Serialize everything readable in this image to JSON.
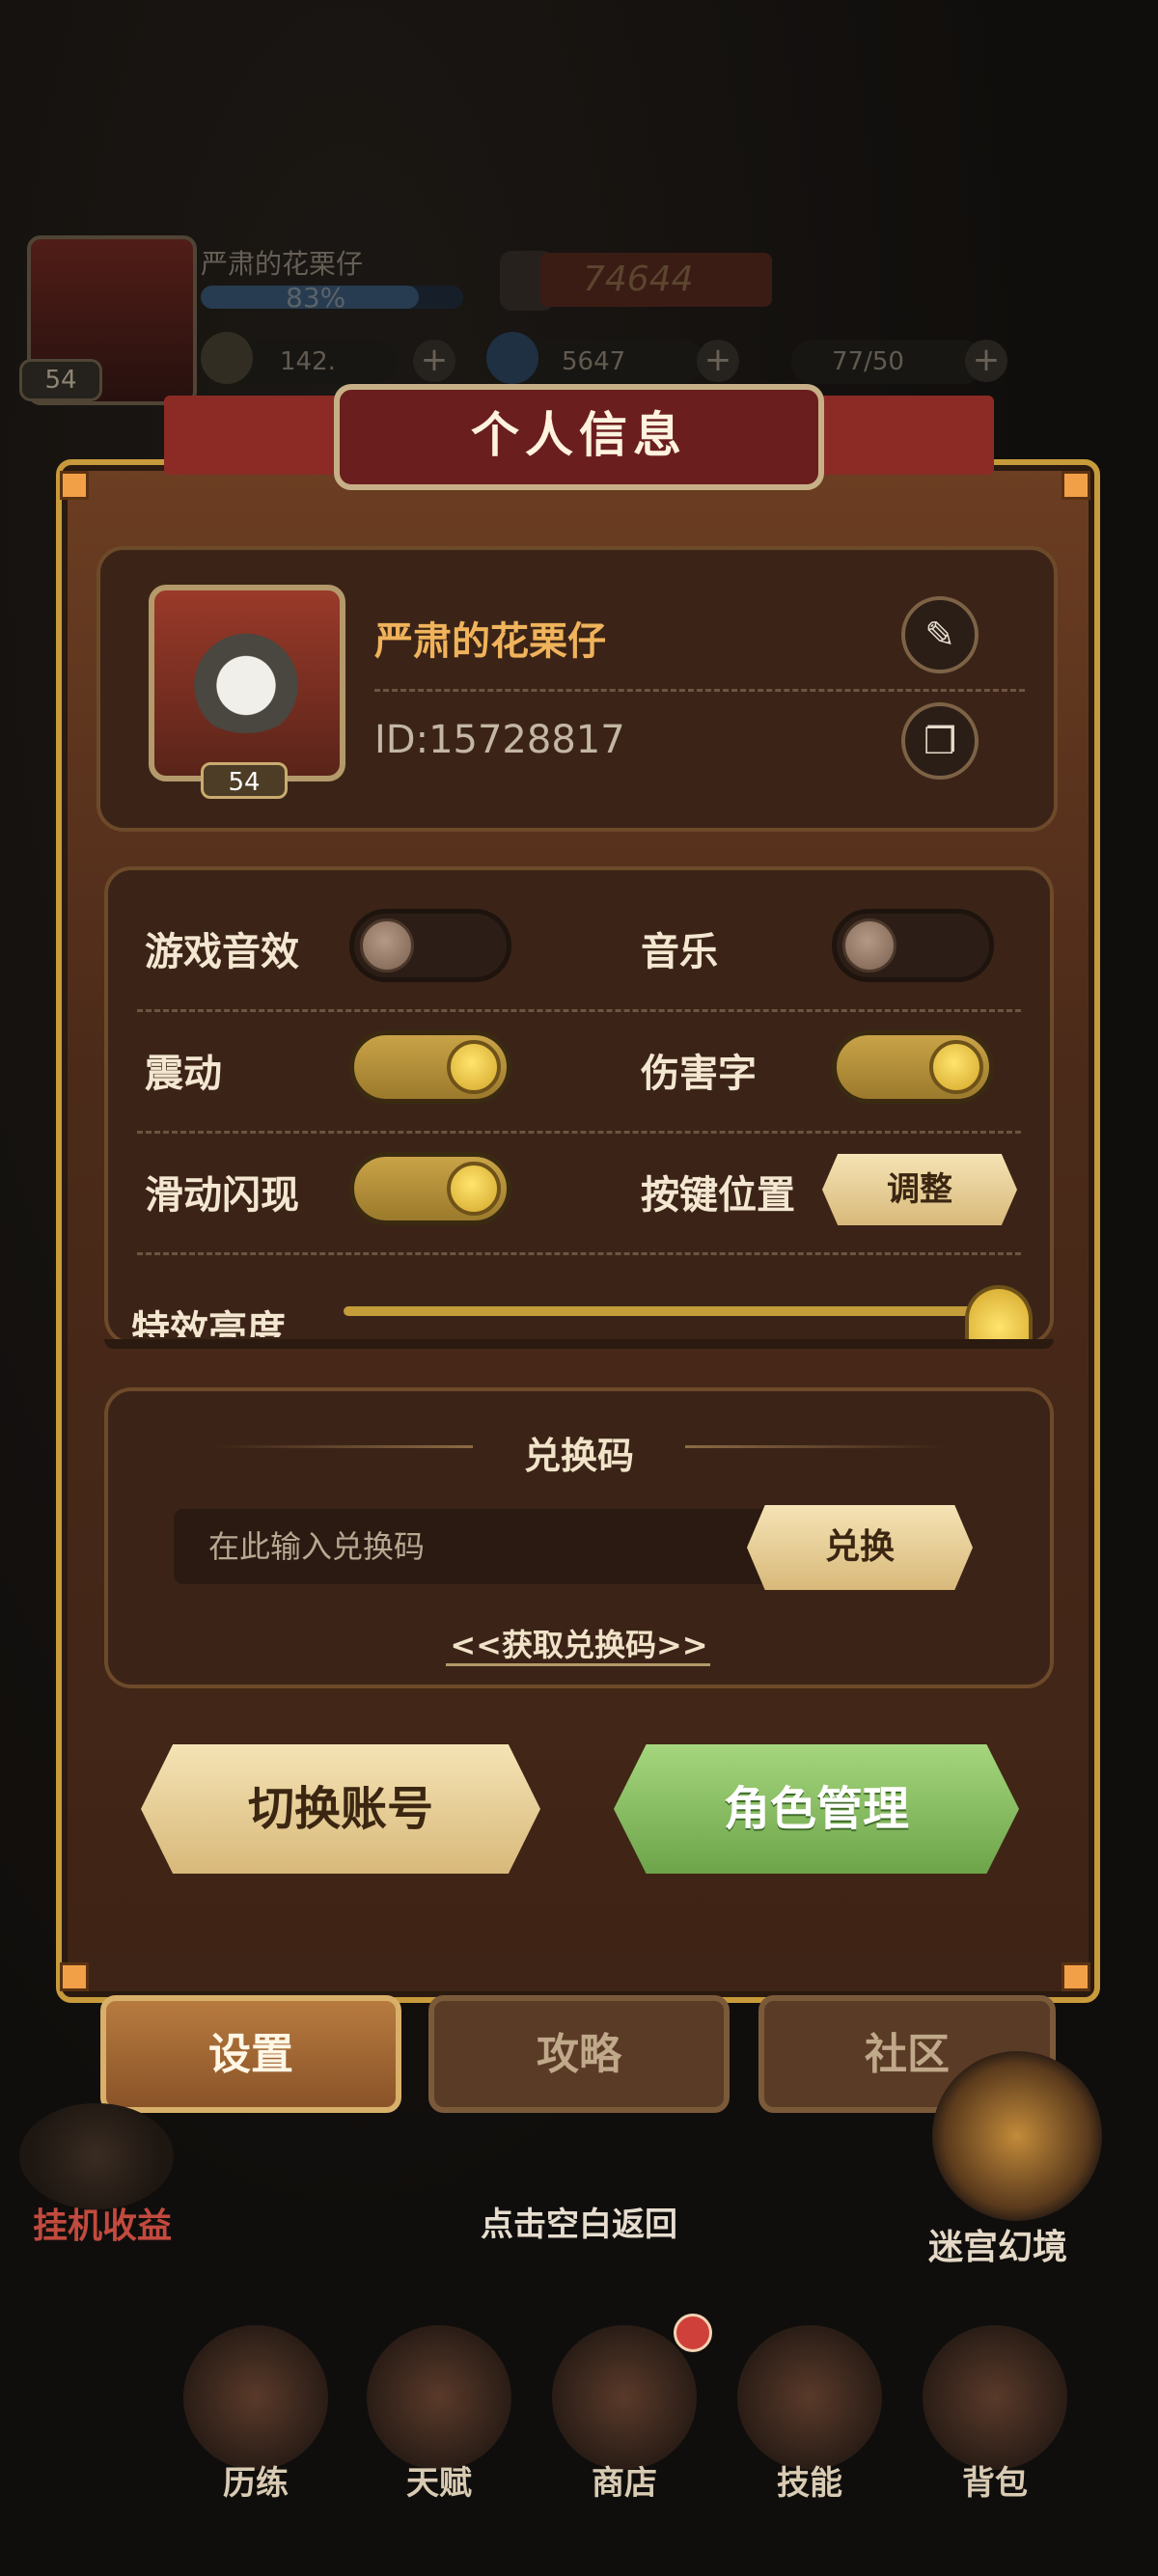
{
  "hud": {
    "player_name": "严肃的花栗仔",
    "xp_percent_text": "83%",
    "xp_fraction": 0.83,
    "level": "54",
    "power": "74644",
    "coins": "142.",
    "gems": "5647",
    "stamina": "77/50"
  },
  "dialog": {
    "title": "个人信息",
    "profile": {
      "name": "严肃的花栗仔",
      "id_text": "ID:15728817",
      "level": "54",
      "edit_icon": "pencil-icon",
      "copy_icon": "copy-icon"
    },
    "settings": [
      {
        "label": "游戏音效",
        "on": false
      },
      {
        "label": "音乐",
        "on": false
      },
      {
        "label": "震动",
        "on": true
      },
      {
        "label": "伤害字",
        "on": true
      },
      {
        "label": "滑动闪现",
        "on": true
      }
    ],
    "key_position": {
      "label": "按键位置",
      "button": "调整"
    },
    "brightness": {
      "label_partial": "特效亮度",
      "level": 0.97
    },
    "redeem": {
      "title": "兑换码",
      "placeholder": "在此输入兑换码",
      "button": "兑换",
      "link": "<<获取兑换码>>"
    },
    "switch_account": "切换账号",
    "role_manage": "角色管理"
  },
  "tabs": [
    "设置",
    "攻略",
    "社区"
  ],
  "active_tab": 0,
  "hint": "点击空白返回",
  "side": {
    "left": "挂机收益",
    "right": "迷宫幻境"
  },
  "bottom_nav": [
    "历练",
    "天赋",
    "商店",
    "技能",
    "背包"
  ],
  "colors": {
    "accent_gold": "#c9a347",
    "green_button": "#8cc466",
    "title_red": "#6b1e1e",
    "panel_brown": "#5a331d"
  }
}
